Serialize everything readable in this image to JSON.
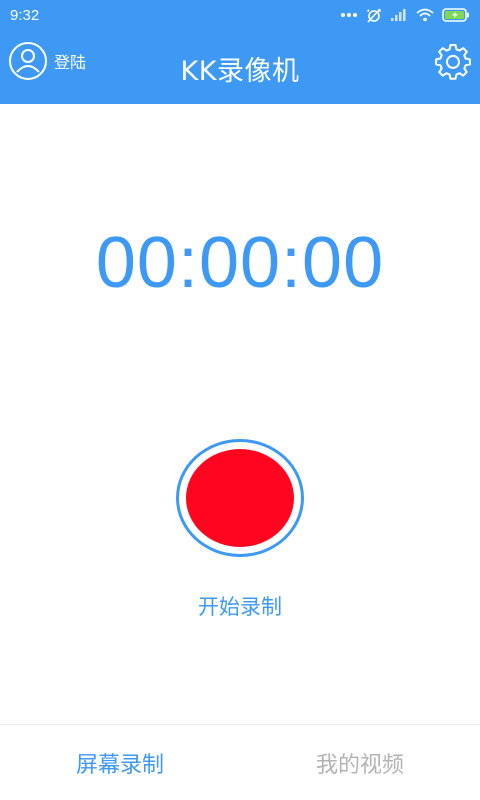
{
  "status_bar": {
    "time": "9:32"
  },
  "app_bar": {
    "login_label": "登陆",
    "title": "KK录像机"
  },
  "recorder": {
    "timer": "00:00:00",
    "record_label": "开始录制"
  },
  "bottom_nav": {
    "tabs": [
      {
        "label": "屏幕录制",
        "active": true
      },
      {
        "label": "我的视频",
        "active": false
      }
    ]
  },
  "colors": {
    "primary": "#3d99f3",
    "record": "#ff0520",
    "inactive_tab": "#b3b3b3"
  },
  "icons": {
    "login": "user-circle-icon",
    "settings": "gear-icon",
    "record": "record-icon"
  }
}
